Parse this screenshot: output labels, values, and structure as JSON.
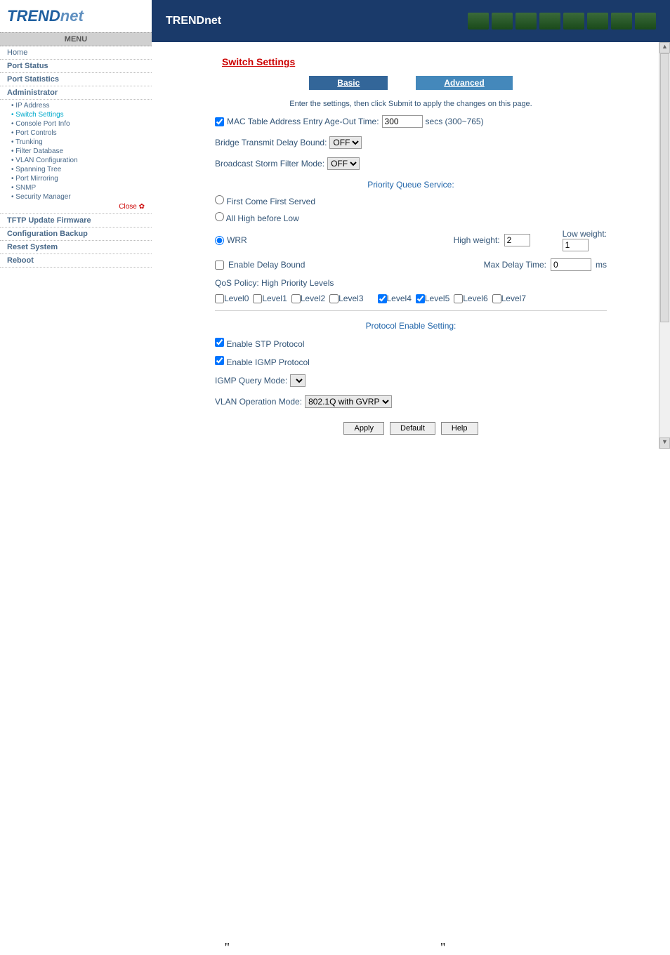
{
  "brand": "TRENDnet",
  "menu": {
    "header": "MENU",
    "items": [
      "Home",
      "Port Status",
      "Port Statistics",
      "Administrator"
    ],
    "admin_items": [
      "IP Address",
      "Switch Settings",
      "Console Port Info",
      "Port Controls",
      "Trunking",
      "Filter Database",
      "VLAN Configuration",
      "Spanning Tree",
      "Port Mirroring",
      "SNMP",
      "Security Manager"
    ],
    "close": "Close ✿",
    "bottom": [
      "TFTP Update Firmware",
      "Configuration Backup",
      "Reset System",
      "Reboot"
    ]
  },
  "page_title": "Switch Settings",
  "tabs": {
    "basic": "Basic",
    "advanced": "Advanced"
  },
  "instructions": "Enter the settings, then click Submit to apply the changes on this page.",
  "mac_table": {
    "label": "MAC Table Address Entry Age-Out Time:",
    "value": "300",
    "unit": "secs (300~765)",
    "checked": true
  },
  "bridge_delay": {
    "label": "Bridge Transmit Delay Bound:",
    "value": "OFF"
  },
  "storm_filter": {
    "label": "Broadcast Storm Filter Mode:",
    "value": "OFF"
  },
  "priority_queue": {
    "title": "Priority Queue Service:",
    "fcfs": "First Come First Served",
    "allhigh": "All High before Low",
    "wrr": "WRR",
    "selected": "wrr",
    "high_weight_label": "High weight:",
    "high_weight_value": "2",
    "low_weight_label": "Low weight:",
    "low_weight_value": "1"
  },
  "delay_bound": {
    "label": "Enable Delay Bound",
    "checked": false,
    "max_label": "Max Delay Time:",
    "max_value": "0",
    "unit": "ms"
  },
  "qos": {
    "policy_label": "QoS Policy: High Priority Levels",
    "levels": [
      {
        "name": "Level0",
        "checked": false
      },
      {
        "name": "Level1",
        "checked": false
      },
      {
        "name": "Level2",
        "checked": false
      },
      {
        "name": "Level3",
        "checked": false
      },
      {
        "name": "Level4",
        "checked": true
      },
      {
        "name": "Level5",
        "checked": true
      },
      {
        "name": "Level6",
        "checked": false
      },
      {
        "name": "Level7",
        "checked": false
      }
    ]
  },
  "protocol": {
    "title": "Protocol Enable Setting:",
    "stp": {
      "label": "Enable STP Protocol",
      "checked": true
    },
    "igmp": {
      "label": "Enable IGMP Protocol",
      "checked": true
    },
    "query_label": "IGMP Query Mode:",
    "vlan_label": "VLAN Operation Mode:",
    "vlan_value": "802.1Q with GVRP"
  },
  "buttons": {
    "apply": "Apply",
    "default": "Default",
    "help": "Help"
  },
  "footer": {
    "q1": "\"",
    "q2": "\""
  }
}
